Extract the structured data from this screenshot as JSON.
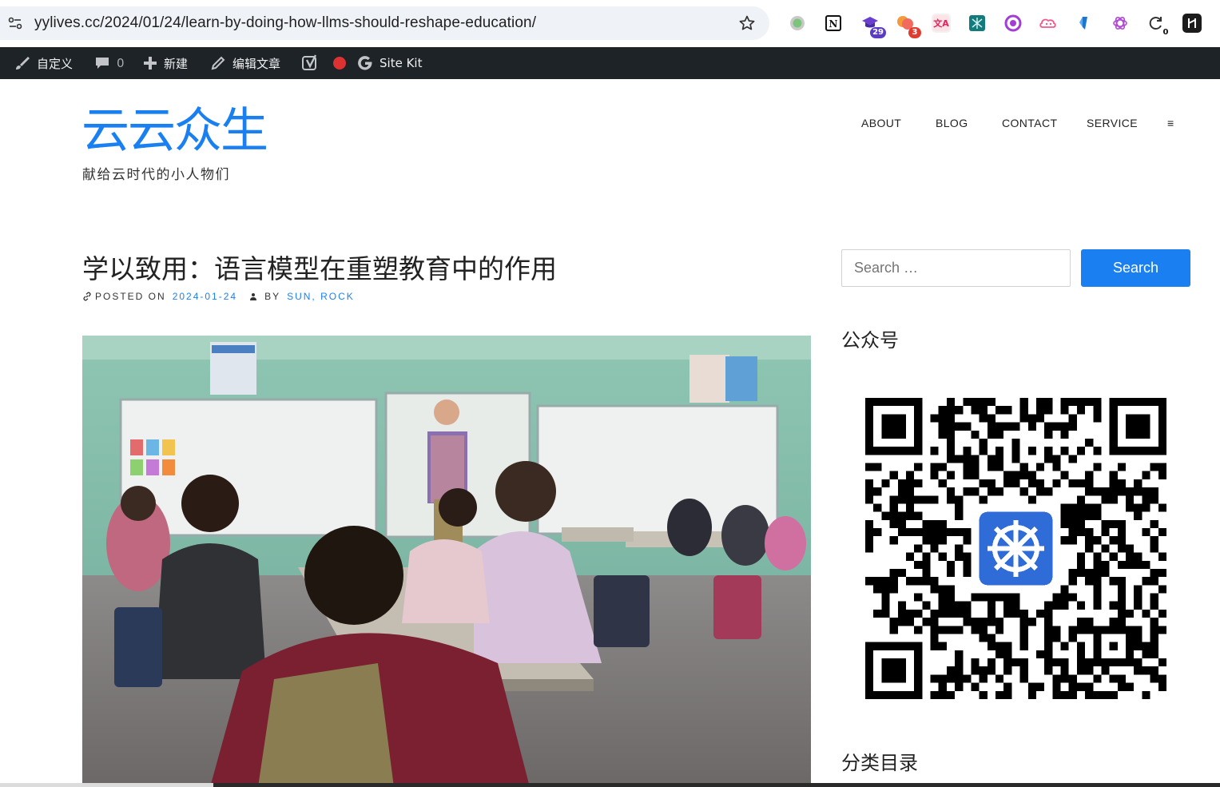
{
  "browser": {
    "url": "yylives.cc/2024/01/24/learn-by-doing-how-llms-should-reshape-education/",
    "extensions": [
      {
        "name": "record-extension-icon",
        "badge": ""
      },
      {
        "name": "notion-extension-icon",
        "badge": ""
      },
      {
        "name": "graduation-cap-extension-icon",
        "badge": "29"
      },
      {
        "name": "chat-bubbles-extension-icon",
        "badge": "3"
      },
      {
        "name": "translate-extension-icon",
        "badge": ""
      },
      {
        "name": "network-extension-icon",
        "badge": ""
      },
      {
        "name": "circle-logo-extension-icon",
        "badge": ""
      },
      {
        "name": "cloud-face-extension-icon",
        "badge": ""
      },
      {
        "name": "bookmark-extension-icon",
        "badge": ""
      },
      {
        "name": "openai-extension-icon",
        "badge": ""
      },
      {
        "name": "refresh-counter-extension-icon",
        "badge": "0"
      },
      {
        "name": "dark-square-extension-icon",
        "badge": ""
      }
    ]
  },
  "adminbar": {
    "customize": "自定义",
    "comments_count": "0",
    "new": "新建",
    "edit_post": "编辑文章",
    "site_kit": "Site Kit"
  },
  "site": {
    "title": "云云众生",
    "description": "献给云时代的小人物们"
  },
  "nav": {
    "items": [
      "ABOUT",
      "BLOG",
      "CONTACT",
      "SERVICE"
    ],
    "menu_toggle": "≡"
  },
  "post": {
    "title": "学以致用：语言模型在重塑教育中的作用",
    "posted_on_label": "POSTED ON",
    "date": "2024-01-24",
    "by_label": "BY",
    "author": "SUN, ROCK"
  },
  "sidebar": {
    "search_placeholder": "Search …",
    "search_button": "Search",
    "widget_wechat_title": "公众号",
    "widget_categories_title": "分类目录"
  },
  "colors": {
    "accent": "#1a80f2",
    "adminbar": "#1d2327"
  }
}
